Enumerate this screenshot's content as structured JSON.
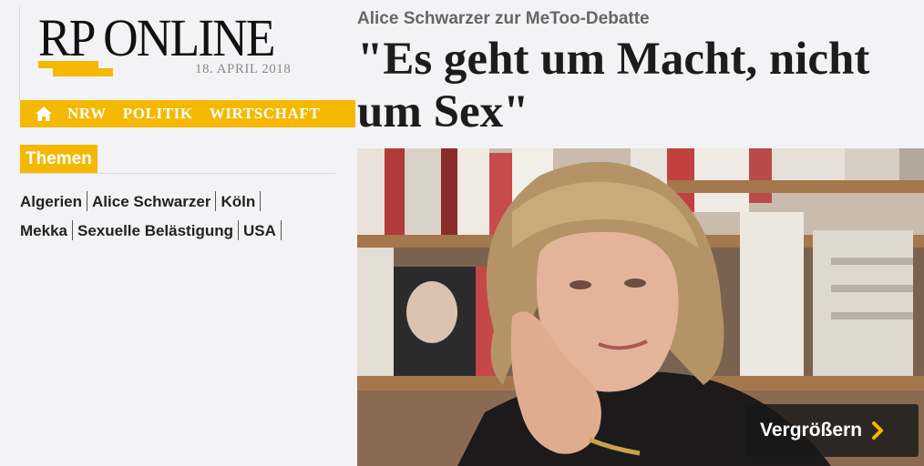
{
  "logo": {
    "brand": "RP ONLINE",
    "date": "18. APRIL 2018"
  },
  "nav": {
    "home_icon": "home-icon",
    "items": [
      "NRW",
      "POLITIK",
      "WIRTSCHAFT"
    ]
  },
  "themen": {
    "heading": "Themen",
    "rows": [
      [
        "Algerien",
        "Alice Schwarzer",
        "Köln"
      ],
      [
        "Mekka",
        "Sexuelle Belästigung",
        "USA"
      ]
    ]
  },
  "article": {
    "kicker": "Alice Schwarzer zur MeToo-Debatte",
    "headline": "\"Es geht um Macht, nicht um Sex\"",
    "enlarge_label": "Vergrößern",
    "enlarge_icon": "chevron-right-icon"
  },
  "colors": {
    "accent": "#f5b800",
    "background": "#f3f3f5"
  }
}
